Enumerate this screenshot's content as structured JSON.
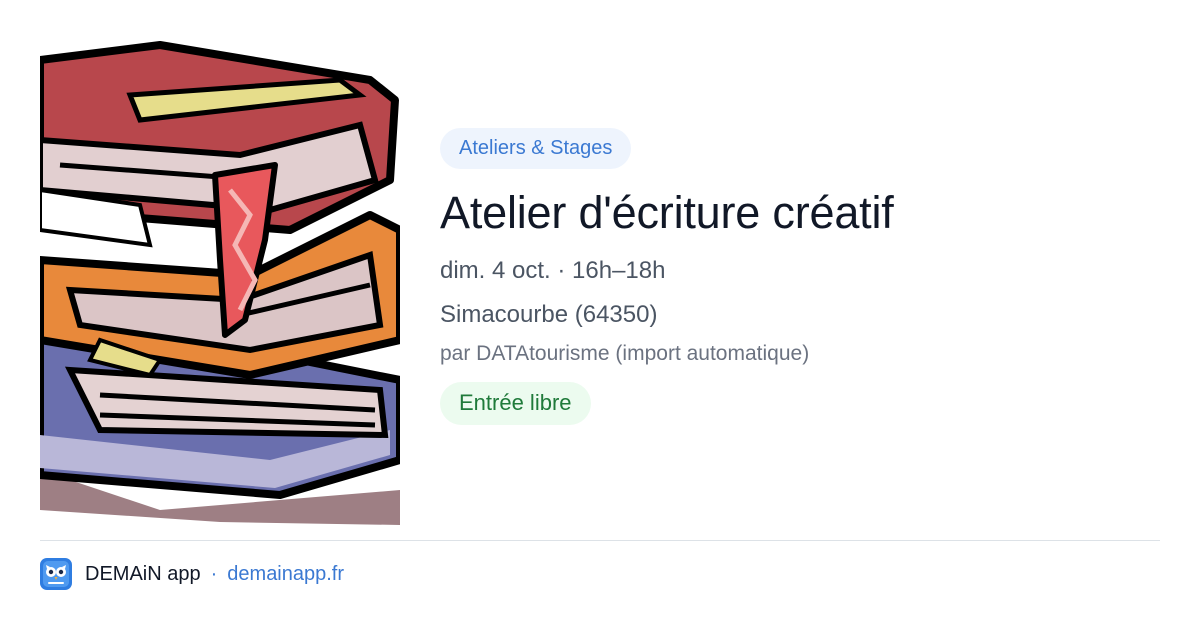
{
  "event": {
    "category": "Ateliers & Stages",
    "title": "Atelier d'écriture créatif",
    "datetime": "dim. 4 oct. · 16h–18h",
    "location": "Simacourbe (64350)",
    "source": "par DATAtourisme (import automatique)",
    "price": "Entrée libre",
    "image_icon": "stack-of-books-clipart"
  },
  "footer": {
    "app_icon": "owl-app-icon",
    "app_name": "DEMAiN app",
    "separator": "·",
    "url": "demainapp.fr"
  },
  "colors": {
    "tag_bg": "#eef4fd",
    "tag_text": "#3b79d2",
    "price_bg": "#ecfbef",
    "price_text": "#1f7a3a",
    "title_text": "#111827",
    "link": "#3b79d2"
  }
}
